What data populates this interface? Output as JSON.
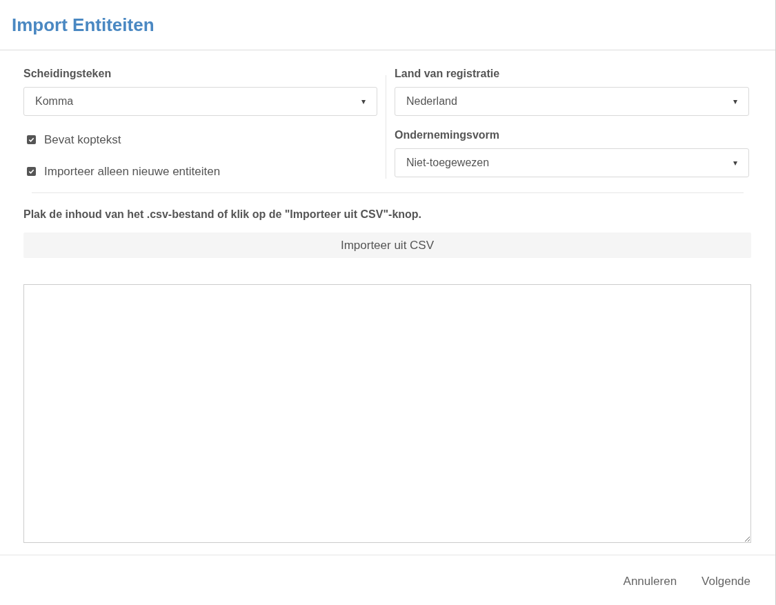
{
  "dialog": {
    "title": "Import Entiteiten"
  },
  "left": {
    "label": "Scheidingsteken",
    "select": {
      "value": "Komma",
      "caret": "▾"
    },
    "checkboxes": [
      {
        "label": "Bevat koptekst",
        "checked": true
      },
      {
        "label": "Importeer alleen nieuwe entiteiten",
        "checked": true
      }
    ]
  },
  "right": {
    "fields": [
      {
        "label": "Land van registratie",
        "value": "Nederland",
        "caret": "▾"
      },
      {
        "label": "Ondernemingsvorm",
        "value": "Niet-toegewezen",
        "caret": "▾"
      }
    ]
  },
  "instruction": "Plak de inhoud van het .csv-bestand of klik op de \"Importeer uit CSV\"-knop.",
  "import_button": "Importeer uit CSV",
  "footer": {
    "buttons": [
      "Annuleren",
      "Volgende"
    ]
  }
}
